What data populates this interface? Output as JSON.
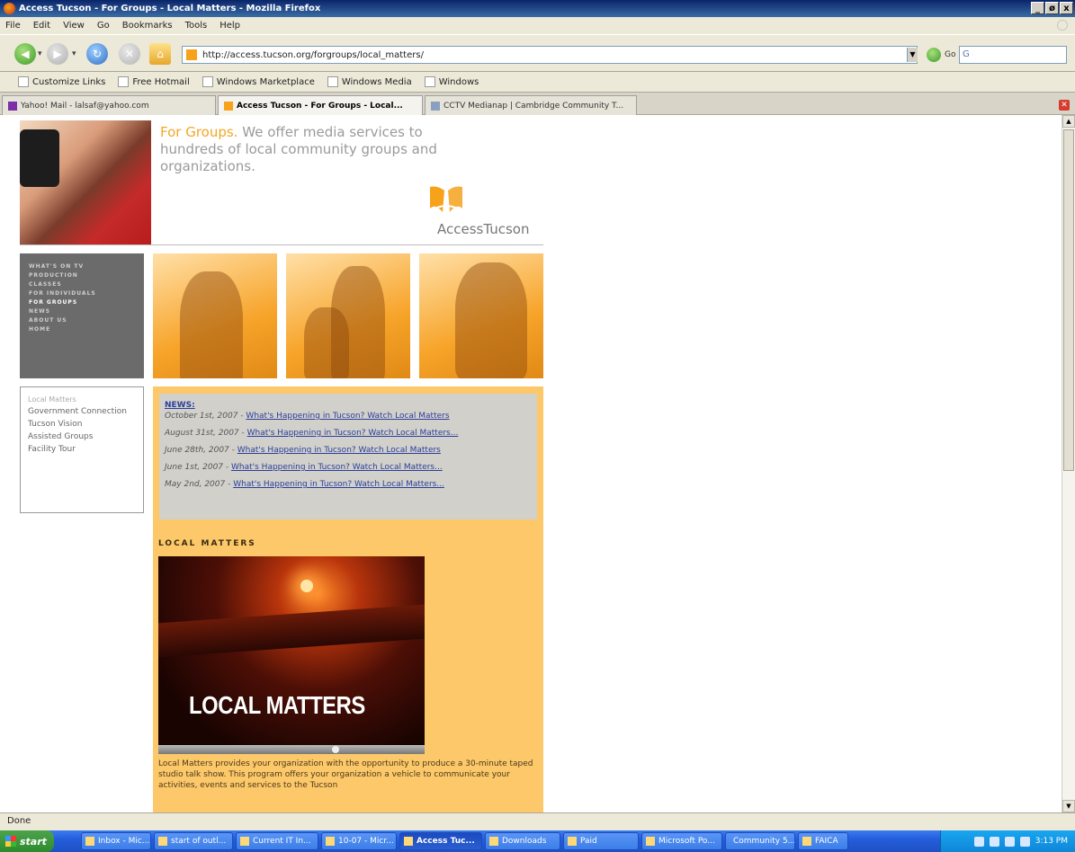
{
  "window": {
    "title": "Access Tucson - For Groups - Local Matters - Mozilla Firefox",
    "controls": [
      "_",
      "ø",
      "x"
    ]
  },
  "menu": [
    "File",
    "Edit",
    "View",
    "Go",
    "Bookmarks",
    "Tools",
    "Help"
  ],
  "address": {
    "url": "http://access.tucson.org/forgroups/local_matters/",
    "go_label": "Go",
    "search_value": "G"
  },
  "bookmarks": [
    "Customize Links",
    "Free Hotmail",
    "Windows Marketplace",
    "Windows Media",
    "Windows"
  ],
  "tabs": [
    {
      "label": "Yahoo! Mail - lalsaf@yahoo.com"
    },
    {
      "label": "Access Tucson - For Groups - Local..."
    },
    {
      "label": "CCTV Medianap | Cambridge Community T..."
    }
  ],
  "page": {
    "hero_highlight": "For Groups.",
    "hero_text": "We offer media services to hundreds of local community groups and organizations.",
    "brand": "AccessTucson",
    "nav": [
      "WHAT'S ON TV",
      "PRODUCTION",
      "CLASSES",
      "FOR INDIVIDUALS",
      "FOR GROUPS",
      "NEWS",
      "ABOUT US",
      "HOME"
    ],
    "sublinks": [
      "Local Matters",
      "Government Connection",
      "Tucson Vision",
      "Assisted Groups",
      "Facility Tour"
    ],
    "news": {
      "title": "NEWS:",
      "items": [
        {
          "date": "October 1st, 2007 - ",
          "link": "What's Happening in Tucson? Watch Local Matters"
        },
        {
          "date": "August 31st, 2007 - ",
          "link": "What's Happening in Tucson? Watch Local Matters..."
        },
        {
          "date": "June 28th, 2007 - ",
          "link": "What's Happening in Tucson? Watch Local Matters"
        },
        {
          "date": "June 1st, 2007 - ",
          "link": "What's Happening in Tucson? Watch Local Matters..."
        },
        {
          "date": "May 2nd, 2007 - ",
          "link": "What's Happening in Tucson? Watch Local Matters..."
        }
      ]
    },
    "section_title": "LOCAL MATTERS",
    "video_title": "LOCAL MATTERS",
    "description": "Local Matters provides your organization with the opportunity to produce a 30-minute taped studio talk show. This program offers your organization a vehicle to communicate your activities, events and services to the Tucson"
  },
  "status": "Done",
  "taskbar": {
    "start": "start",
    "tasks": [
      {
        "label": "Inbox - Mic..."
      },
      {
        "label": "start of outl..."
      },
      {
        "label": "Current IT In..."
      },
      {
        "label": "10-07 - Micr..."
      },
      {
        "label": "Access Tuc..."
      },
      {
        "label": "Downloads"
      },
      {
        "label": "Paid"
      },
      {
        "label": "Microsoft Po..."
      },
      {
        "label": "Community 5..."
      },
      {
        "label": "FAICA"
      }
    ],
    "clock": "3:13 PM"
  }
}
